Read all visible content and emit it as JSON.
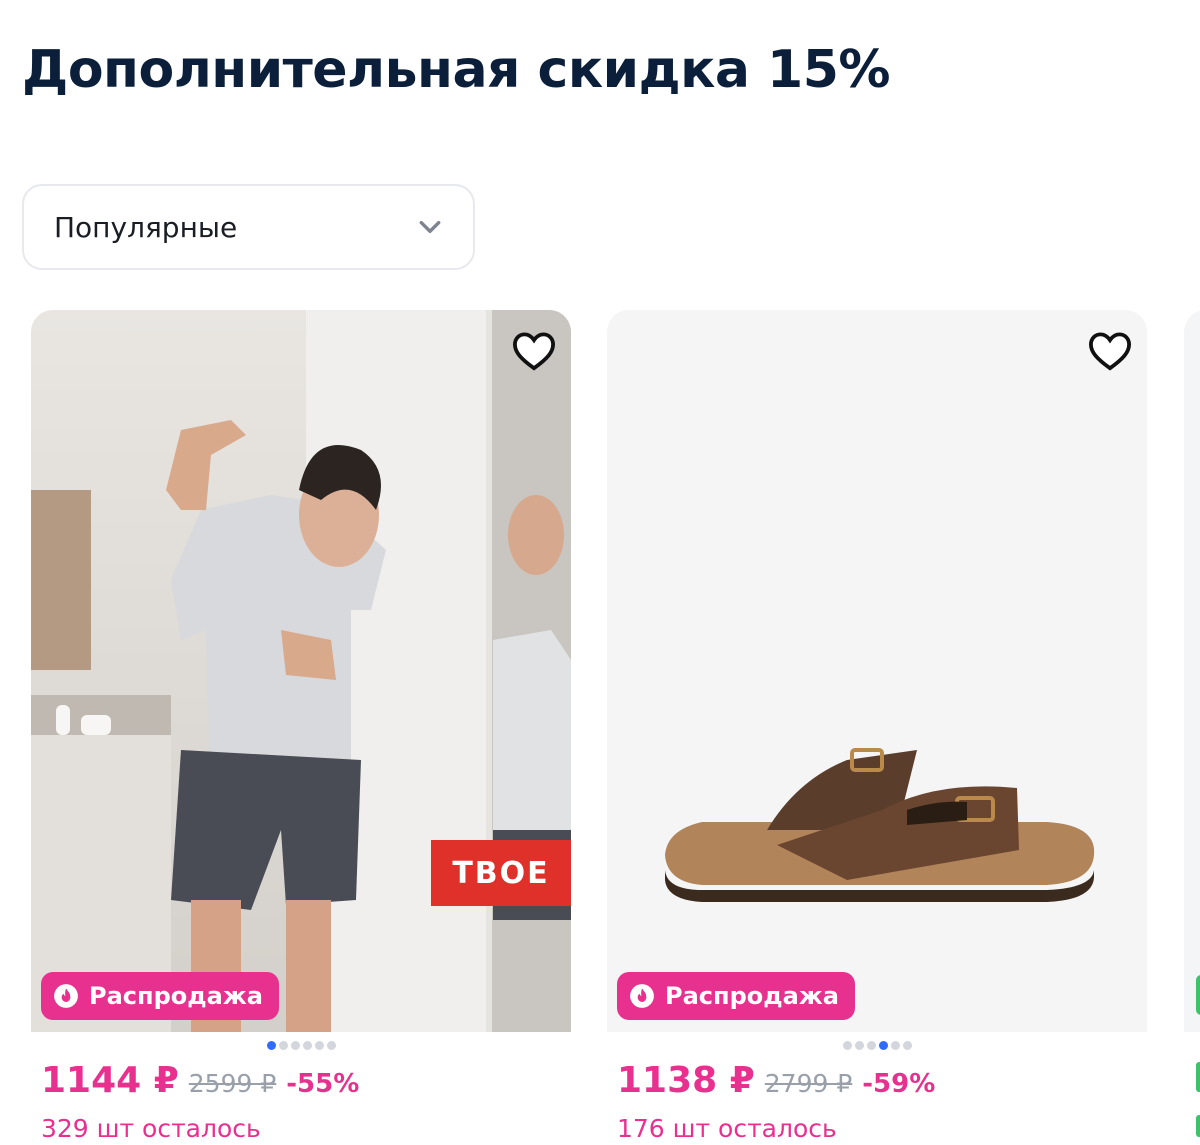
{
  "page": {
    "title": "Дополнительная скидка 15%"
  },
  "sort": {
    "selected": "Популярные",
    "icon": "chevron-down-icon"
  },
  "colors": {
    "accent": "#e8308f",
    "dot_active": "#2f6bff",
    "brand_badge": "#e0302a"
  },
  "products": [
    {
      "badge": "Распродажа",
      "brand_label": "ТВОЕ",
      "price": "1144 ₽",
      "old_price": "2599 ₽",
      "discount": "-55%",
      "stock": "329 шт осталось",
      "image_count": 6,
      "active_image": 0
    },
    {
      "badge": "Распродажа",
      "price": "1138 ₽",
      "old_price": "2799 ₽",
      "discount": "-59%",
      "stock": "176 шт осталось",
      "image_count": 6,
      "active_image": 3
    }
  ]
}
